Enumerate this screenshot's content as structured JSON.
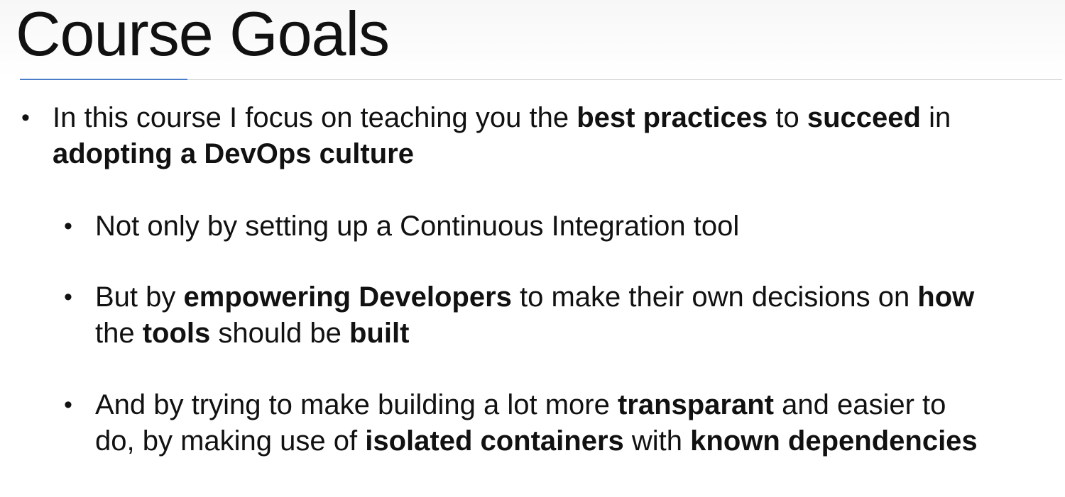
{
  "slide": {
    "title": "Course Goals",
    "bullet_glyph": "•",
    "bullets": [
      {
        "lines": [
          [
            {
              "text": "In this course I focus on teaching you the ",
              "bold": false
            },
            {
              "text": "best practices",
              "bold": true
            },
            {
              "text": " to ",
              "bold": false
            },
            {
              "text": "succeed",
              "bold": true
            },
            {
              "text": " in",
              "bold": false
            }
          ],
          [
            {
              "text": "adopting a DevOps culture",
              "bold": true
            }
          ]
        ]
      },
      {
        "lines": [
          [
            {
              "text": "Not only by setting up a Continuous Integration tool",
              "bold": false
            }
          ]
        ]
      },
      {
        "lines": [
          [
            {
              "text": "But by ",
              "bold": false
            },
            {
              "text": "empowering Developers",
              "bold": true
            },
            {
              "text": " to make their own decisions on ",
              "bold": false
            },
            {
              "text": "how",
              "bold": true
            }
          ],
          [
            {
              "text": "the ",
              "bold": false
            },
            {
              "text": "tools",
              "bold": true
            },
            {
              "text": " should be ",
              "bold": false
            },
            {
              "text": "built",
              "bold": true
            }
          ]
        ]
      },
      {
        "lines": [
          [
            {
              "text": "And by trying to make building a lot more ",
              "bold": false
            },
            {
              "text": "transparant",
              "bold": true
            },
            {
              "text": " and easier to",
              "bold": false
            }
          ],
          [
            {
              "text": "do, by making use of ",
              "bold": false
            },
            {
              "text": "isolated containers",
              "bold": true
            },
            {
              "text": " with ",
              "bold": false
            },
            {
              "text": "known dependencies",
              "bold": true
            }
          ]
        ]
      }
    ]
  }
}
